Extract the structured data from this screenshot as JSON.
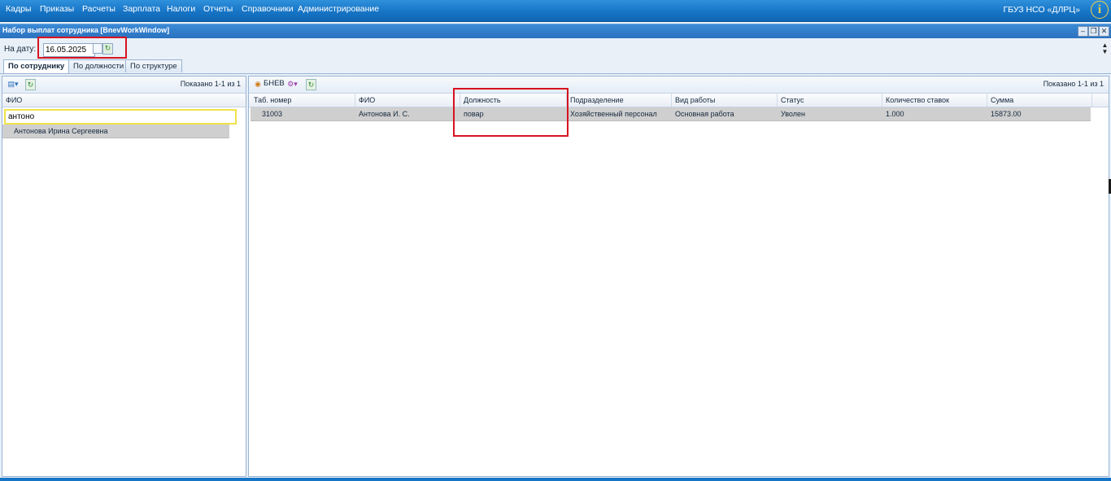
{
  "menu": {
    "items": [
      "Кадры",
      "Приказы",
      "Расчеты",
      "Зарплата",
      "Налоги",
      "Отчеты",
      "Справочники",
      "Администрирование"
    ],
    "org": "ГБУЗ НСО «ДЛРЦ»",
    "info_icon": "info-icon"
  },
  "window": {
    "title": "Набор выплат сотрудника [BnevWorkWindow]",
    "buttons": [
      "minimize",
      "restore",
      "close"
    ]
  },
  "date": {
    "label": "На дату:",
    "value": "16.05.2025"
  },
  "tabs": [
    {
      "label": "По сотруднику",
      "active": true
    },
    {
      "label": "По должности",
      "active": false
    },
    {
      "label": "По структуре",
      "active": false
    }
  ],
  "left_panel": {
    "shown": "Показано 1-1 из 1",
    "column": "ФИО",
    "filter_value": "антоно",
    "rows": [
      "Антонова Ирина Сергеевна"
    ]
  },
  "right_panel": {
    "toolbar_label": "БНЕВ",
    "shown": "Показано 1-1 из 1",
    "columns": [
      "Таб. номер",
      "ФИО",
      "Должность",
      "Подразделение",
      "Вид работы",
      "Статус",
      "Количество ставок",
      "Сумма"
    ],
    "rows": [
      [
        "31003",
        "Антонова И. С.",
        "повар",
        "Хозяйственный персонал",
        "Основная работа",
        "Уволен",
        "1.000",
        "15873.00"
      ]
    ]
  },
  "colors": {
    "menu_bar": "#1775c6",
    "highlight": "#d8121f",
    "filter_border": "#f0e24a"
  }
}
